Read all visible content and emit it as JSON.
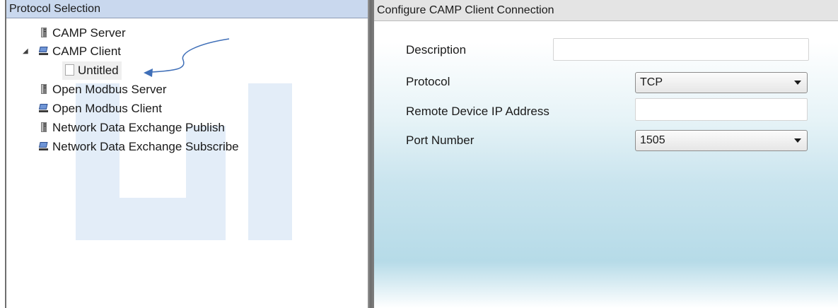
{
  "left_pane": {
    "header": "Protocol Selection",
    "tree": [
      {
        "label": "CAMP Server",
        "icon": "server-icon"
      },
      {
        "label": "CAMP Client",
        "icon": "client-icon",
        "expanded": true
      },
      {
        "label": "Untitled",
        "icon": "document-icon",
        "selected": true
      },
      {
        "label": "Open Modbus Server",
        "icon": "server-icon"
      },
      {
        "label": "Open Modbus Client",
        "icon": "client-icon"
      },
      {
        "label": "Network Data Exchange Publish",
        "icon": "server-icon"
      },
      {
        "label": "Network Data Exchange Subscribe",
        "icon": "client-icon"
      }
    ],
    "expander_glyph": "◢"
  },
  "right_pane": {
    "header": "Configure CAMP Client Connection",
    "description_label": "Description",
    "description_value": "",
    "protocol_label": "Protocol",
    "protocol_value": "TCP",
    "remote_ip_label": "Remote Device IP Address",
    "remote_ip_value": "",
    "port_label": "Port Number",
    "port_value": "1505"
  },
  "colors": {
    "accent_arrow": "#3f6fb8",
    "watermark": "#dfeaf7"
  }
}
